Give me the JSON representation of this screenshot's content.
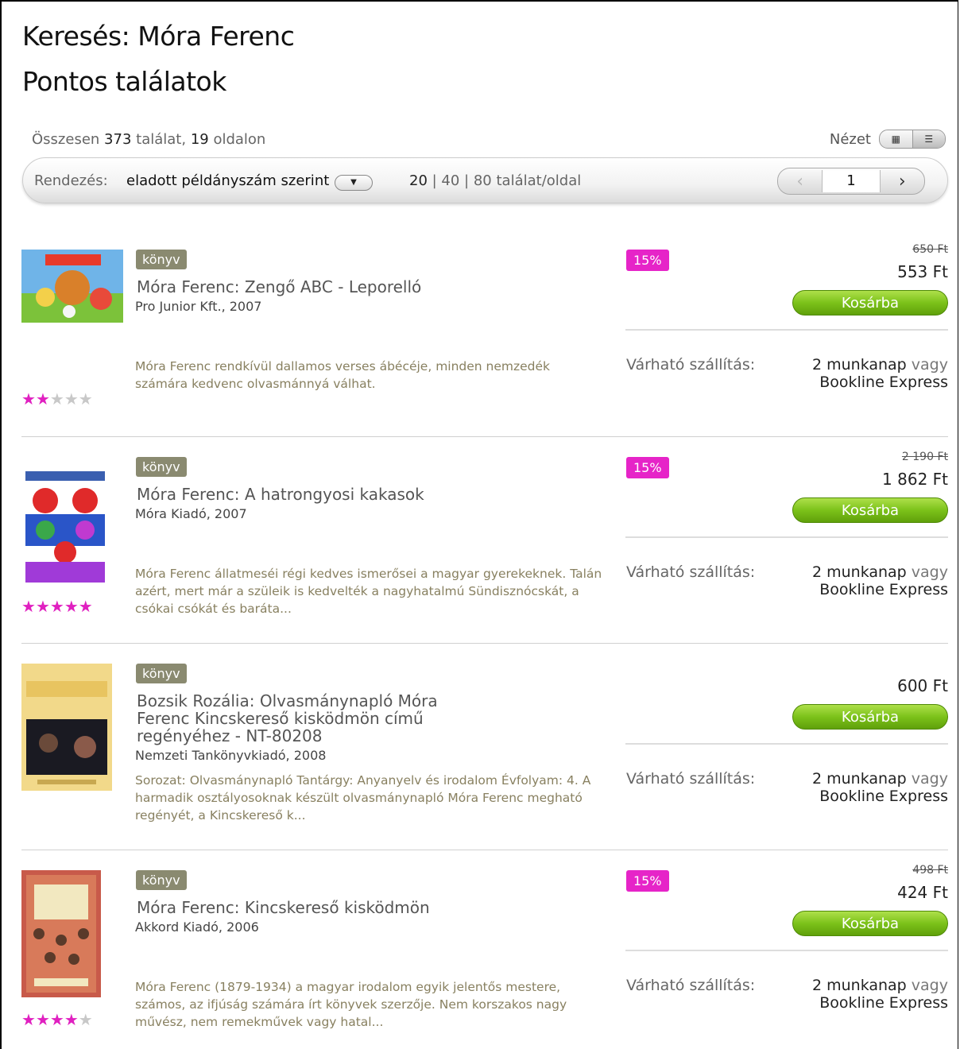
{
  "search_title": "Keresés: Móra Ferenc",
  "section_title": "Pontos találatok",
  "summary": {
    "prefix": "Összesen",
    "count": "373",
    "mid": "találat,",
    "pages": "19",
    "suffix": "oldalon"
  },
  "view": {
    "label": "Nézet"
  },
  "sort": {
    "label": "Rendezés:",
    "value": "eladott példányszám szerint",
    "perpage_options": [
      "20",
      "40",
      "80"
    ],
    "perpage_suffix": "találat/oldal"
  },
  "pager": {
    "current": "1"
  },
  "items": [
    {
      "type": "könyv",
      "title": "Móra Ferenc: Zengő ABC - Leporelló",
      "publisher": "Pro Junior Kft., 2007",
      "description": "Móra Ferenc rendkívül dallamos verses ábécéje, minden nemzedék számára kedvenc olvasmánnyá válhat.",
      "rating": 2,
      "discount": "15%",
      "old_price": "650 Ft",
      "price": "553 Ft",
      "cart": "Kosárba",
      "ship_label": "Várható szállítás:",
      "ship_days": "2 munkanap",
      "ship_or": "vagy",
      "ship_express": "Bookline Express"
    },
    {
      "type": "könyv",
      "title": "Móra Ferenc: A hatrongyosi kakasok",
      "publisher": "Móra Kiadó, 2007",
      "description": "Móra Ferenc állatmeséi régi kedves ismerősei a magyar gyerekeknek. Talán azért, mert már a szüleik is kedvelték a nagyhatalmú Sündisznócskát, a csókai csókát és baráta...",
      "rating": 5,
      "discount": "15%",
      "old_price": "2 190 Ft",
      "price": "1 862 Ft",
      "cart": "Kosárba",
      "ship_label": "Várható szállítás:",
      "ship_days": "2 munkanap",
      "ship_or": "vagy",
      "ship_express": "Bookline Express"
    },
    {
      "type": "könyv",
      "title": "Bozsik Rozália: Olvasmánynapló Móra Ferenc Kincskereső kisködmön című regényéhez - NT-80208",
      "publisher": "Nemzeti Tankönyvkiadó, 2008",
      "description": "Sorozat: Olvasmánynapló Tantárgy: Anyanyelv és irodalom Évfolyam: 4. A harmadik osztályosoknak készült olvasmánynapló Móra Ferenc megható regényét, a Kincskereső k...",
      "rating": null,
      "discount": "",
      "old_price": "",
      "price": "600 Ft",
      "cart": "Kosárba",
      "ship_label": "Várható szállítás:",
      "ship_days": "2 munkanap",
      "ship_or": "vagy",
      "ship_express": "Bookline Express"
    },
    {
      "type": "könyv",
      "title": "Móra Ferenc: Kincskereső kisködmön",
      "publisher": "Akkord Kiadó, 2006",
      "description": "Móra Ferenc (1879-1934) a magyar irodalom egyik jelentős mestere, számos, az ifjúság számára írt könyvek szerzője. Nem korszakos nagy művész, nem remekművek vagy hatal...",
      "rating": 4,
      "discount": "15%",
      "old_price": "498 Ft",
      "price": "424 Ft",
      "cart": "Kosárba",
      "ship_label": "Várható szállítás:",
      "ship_days": "2 munkanap",
      "ship_or": "vagy",
      "ship_express": "Bookline Express"
    }
  ],
  "colors": {
    "discount": "#e624c8",
    "cart": "#7cc21a",
    "star_on": "#e020c0",
    "badge": "#8a8a70"
  },
  "icons": {
    "view_grid": "grid-view-icon",
    "view_list": "list-view-icon",
    "prev": "chevron-left-icon",
    "next": "chevron-right-icon",
    "dropdown": "chevron-down-icon"
  }
}
